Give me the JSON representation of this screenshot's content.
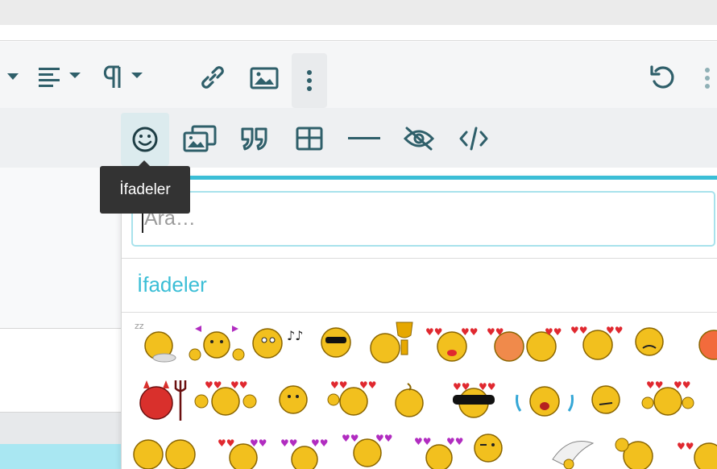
{
  "toolbar": {
    "row1": [
      {
        "name": "insert-dropdown-caret",
        "icon": "caret-down-icon"
      },
      {
        "name": "align-button",
        "icon": "align-left-icon"
      },
      {
        "name": "paragraph-format-button",
        "icon": "pilcrow-icon"
      },
      {
        "name": "link-button",
        "icon": "link-icon"
      },
      {
        "name": "image-button",
        "icon": "image-icon"
      },
      {
        "name": "more-options-button",
        "icon": "vertical-dots-icon"
      },
      {
        "name": "undo-button",
        "icon": "undo-icon"
      },
      {
        "name": "overflow-button",
        "icon": "vertical-dots-icon"
      }
    ],
    "row2": [
      {
        "name": "emoji-button",
        "icon": "smiley-icon"
      },
      {
        "name": "gallery-button",
        "icon": "gallery-icon"
      },
      {
        "name": "quote-button",
        "icon": "quote-icon"
      },
      {
        "name": "table-button",
        "icon": "table-icon"
      },
      {
        "name": "horizontal-line-button",
        "icon": "horizontal-line-icon"
      },
      {
        "name": "spoiler-button",
        "icon": "eye-slash-icon"
      },
      {
        "name": "code-button",
        "icon": "code-icon"
      }
    ]
  },
  "tooltip": {
    "text": "İfadeler"
  },
  "emoji_picker": {
    "search_placeholder": "Ara…",
    "category_title": "İfadeler",
    "accent_color": "#3bbed6"
  },
  "colors": {
    "icon": "#2f5f6a",
    "accent": "#3bbed6",
    "smiley_yellow": "#f2c01e",
    "hearts": "#e0282f"
  }
}
